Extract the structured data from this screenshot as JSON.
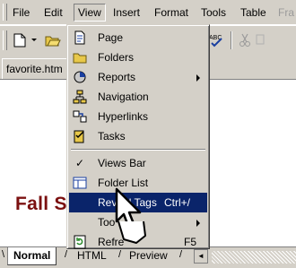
{
  "menubar": {
    "items": [
      {
        "label": "File"
      },
      {
        "label": "Edit"
      },
      {
        "label": "View"
      },
      {
        "label": "Insert"
      },
      {
        "label": "Format"
      },
      {
        "label": "Tools"
      },
      {
        "label": "Table"
      },
      {
        "label": "Fra"
      }
    ]
  },
  "document_tab": {
    "label": "favorite.htm"
  },
  "page_heading": "Fall S",
  "view_menu": {
    "items": [
      {
        "label": "Page",
        "icon": "page-icon"
      },
      {
        "label": "Folders",
        "icon": "folder-icon"
      },
      {
        "label": "Reports",
        "icon": "reports-icon",
        "submenu": true
      },
      {
        "label": "Navigation",
        "icon": "navigation-icon"
      },
      {
        "label": "Hyperlinks",
        "icon": "hyperlinks-icon"
      },
      {
        "label": "Tasks",
        "icon": "tasks-icon"
      },
      {
        "label": "Views Bar",
        "checked": true
      },
      {
        "label": "Folder List",
        "icon": "folder-list-icon"
      },
      {
        "label": "Reveal Tags",
        "shortcut": "Ctrl+/",
        "highlighted": true
      },
      {
        "label": "Too",
        "submenu": true
      },
      {
        "label": "Refre",
        "shortcut": "F5",
        "icon": "refresh-icon"
      }
    ]
  },
  "bottom_tabs": [
    {
      "label": "Normal",
      "selected": true
    },
    {
      "label": "HTML"
    },
    {
      "label": "Preview"
    }
  ],
  "colors": {
    "chrome": "#d4d0c8",
    "highlight": "#0a246a",
    "heading": "#7b1010"
  }
}
